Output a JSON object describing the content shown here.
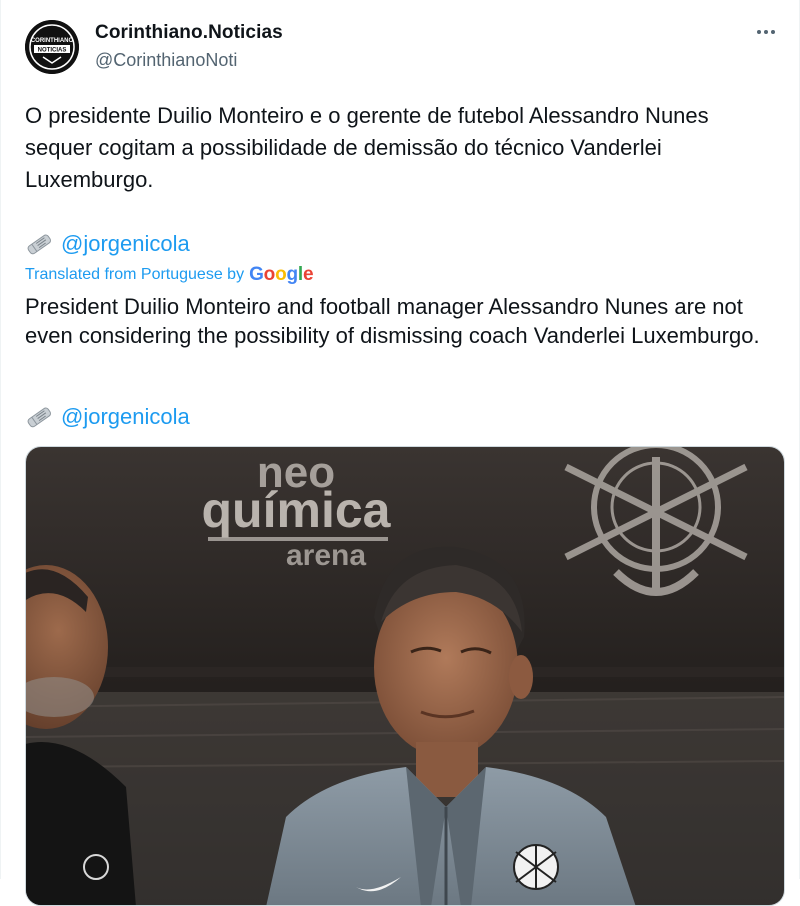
{
  "author": {
    "display_name": "Corinthiano.Noticias",
    "handle": "@CorinthianoNoti",
    "avatar_text_top": "CORINTHIANO",
    "avatar_text_bottom": "NOTICIAS"
  },
  "tweet": {
    "text": "O presidente Duilio Monteiro e o gerente de futebol Alessandro Nunes sequer cogitam a possibilidade de demissão do técnico Vanderlei Luxemburgo.",
    "source_mention": "@jorgenicola",
    "source_icon": "rolled-newspaper-icon"
  },
  "translation": {
    "label": "Translated from Portuguese by",
    "provider": [
      "G",
      "o",
      "o",
      "g",
      "l",
      "e"
    ],
    "text": "President Duilio Monteiro and football manager Alessandro Nunes are not even considering the possibility of dismissing coach Vanderlei Luxemburgo.",
    "source_mention": "@jorgenicola"
  },
  "media": {
    "wall_text_1": "neo",
    "wall_text_2": "química",
    "wall_text_3": "arena"
  },
  "colors": {
    "link": "#1d9bf0",
    "text": "#0f1419",
    "secondary": "#536471"
  },
  "more_icon": "ellipsis-icon"
}
